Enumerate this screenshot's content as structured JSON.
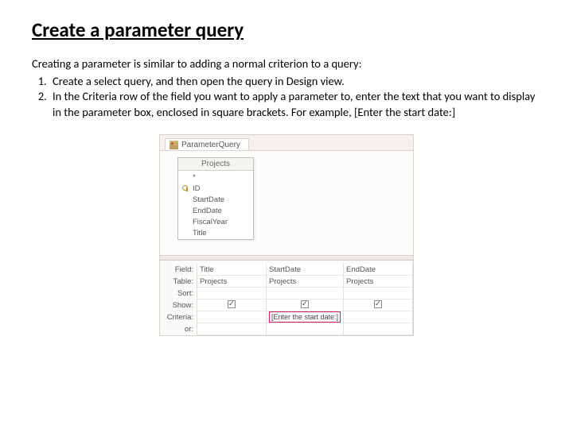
{
  "title": "Create a parameter query",
  "intro": "Creating a parameter is similar to adding a normal criterion to a query:",
  "steps": [
    "Create a select query, and then open the query in Design view.",
    "In the Criteria row of the field you want to apply a parameter to, enter the text that you want to display in the parameter box, enclosed in square brackets. For example, [Enter the start date:]"
  ],
  "designer": {
    "tab_label": "ParameterQuery",
    "table_name": "Projects",
    "fields": [
      "*",
      "ID",
      "StartDate",
      "EndDate",
      "FiscalYear",
      "Title"
    ],
    "pk_field": "ID",
    "row_labels": [
      "Field:",
      "Table:",
      "Sort:",
      "Show:",
      "Criteria:",
      "or:"
    ],
    "columns": [
      {
        "field": "Title",
        "table": "Projects",
        "show": true,
        "criteria": ""
      },
      {
        "field": "StartDate",
        "table": "Projects",
        "show": true,
        "criteria": "[Enter the start date:]"
      },
      {
        "field": "EndDate",
        "table": "Projects",
        "show": true,
        "criteria": ""
      }
    ]
  }
}
